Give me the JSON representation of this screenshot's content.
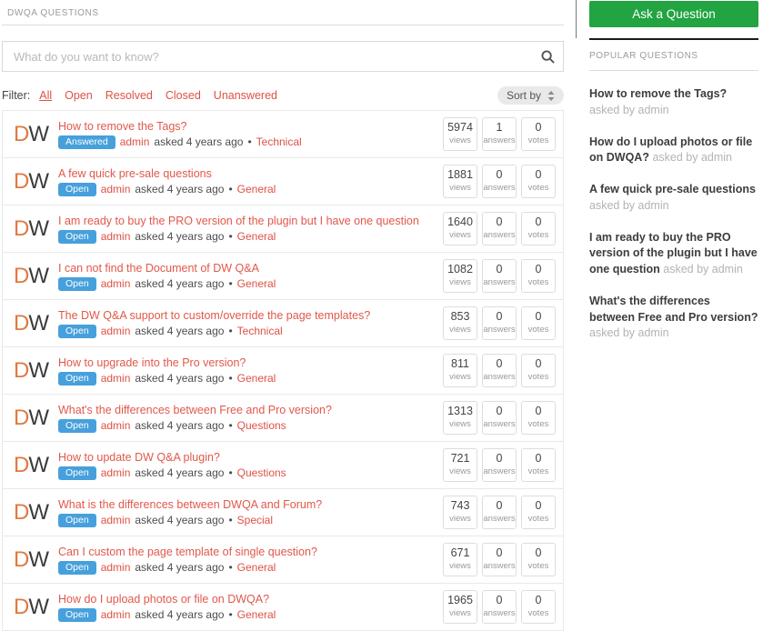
{
  "page": {
    "title": "DWQA QUESTIONS"
  },
  "search": {
    "placeholder": "What do you want to know?"
  },
  "filter": {
    "label": "Filter:",
    "options": [
      {
        "label": "All",
        "active": true
      },
      {
        "label": "Open"
      },
      {
        "label": "Resolved"
      },
      {
        "label": "Closed"
      },
      {
        "label": "Unanswered"
      }
    ]
  },
  "sort": {
    "label": "Sort by"
  },
  "list": {
    "avatar": {
      "first": "D",
      "second": "W"
    },
    "asked_text": "asked 4 years ago",
    "meta_separator": "•",
    "stats_labels": {
      "views": "views",
      "answers": "answers",
      "votes": "votes"
    },
    "questions": [
      {
        "title": "How to remove the Tags?",
        "status": "Answered",
        "author": "admin",
        "category": "Technical",
        "views": "5974",
        "answers": "1",
        "votes": "0"
      },
      {
        "title": "A few quick pre-sale questions",
        "status": "Open",
        "author": "admin",
        "category": "General",
        "views": "1881",
        "answers": "0",
        "votes": "0"
      },
      {
        "title": "I am ready to buy the PRO version of the plugin but I have one question",
        "status": "Open",
        "author": "admin",
        "category": "General",
        "views": "1640",
        "answers": "0",
        "votes": "0"
      },
      {
        "title": "I can not find the Document of DW Q&A",
        "status": "Open",
        "author": "admin",
        "category": "General",
        "views": "1082",
        "answers": "0",
        "votes": "0"
      },
      {
        "title": "The DW Q&A support to custom/override the page templates?",
        "status": "Open",
        "author": "admin",
        "category": "Technical",
        "views": "853",
        "answers": "0",
        "votes": "0"
      },
      {
        "title": "How to upgrade into the Pro version?",
        "status": "Open",
        "author": "admin",
        "category": "General",
        "views": "811",
        "answers": "0",
        "votes": "0"
      },
      {
        "title": "What's the differences between Free and Pro version?",
        "status": "Open",
        "author": "admin",
        "category": "Questions",
        "views": "1313",
        "answers": "0",
        "votes": "0"
      },
      {
        "title": "How to update DW Q&A plugin?",
        "status": "Open",
        "author": "admin",
        "category": "Questions",
        "views": "721",
        "answers": "0",
        "votes": "0"
      },
      {
        "title": "What is the differences between DWQA and Forum?",
        "status": "Open",
        "author": "admin",
        "category": "Special",
        "views": "743",
        "answers": "0",
        "votes": "0"
      },
      {
        "title": "Can I custom the page template of single question?",
        "status": "Open",
        "author": "admin",
        "category": "General",
        "views": "671",
        "answers": "0",
        "votes": "0"
      },
      {
        "title": "How do I upload photos or file on DWQA?",
        "status": "Open",
        "author": "admin",
        "category": "General",
        "views": "1965",
        "answers": "0",
        "votes": "0"
      }
    ]
  },
  "sidebar": {
    "ask_button": "Ask a Question",
    "popular_title": "POPULAR QUESTIONS",
    "popular": [
      {
        "title": "How to remove the Tags?",
        "suffix": "asked by admin"
      },
      {
        "title": "How do I upload photos or file on DWQA?",
        "suffix": "asked by admin"
      },
      {
        "title": "A few quick pre-sale questions",
        "suffix": "asked by admin"
      },
      {
        "title": "I am ready to buy the PRO version of the plugin but I have one question",
        "suffix": "asked by admin"
      },
      {
        "title": "What's the differences between Free and Pro version?",
        "suffix": "asked by admin"
      }
    ]
  },
  "colors": {
    "accent_red": "#e1584b",
    "badge_blue": "#47a0dc",
    "button_green": "#21a441",
    "avatar_orange": "#e0793f"
  }
}
